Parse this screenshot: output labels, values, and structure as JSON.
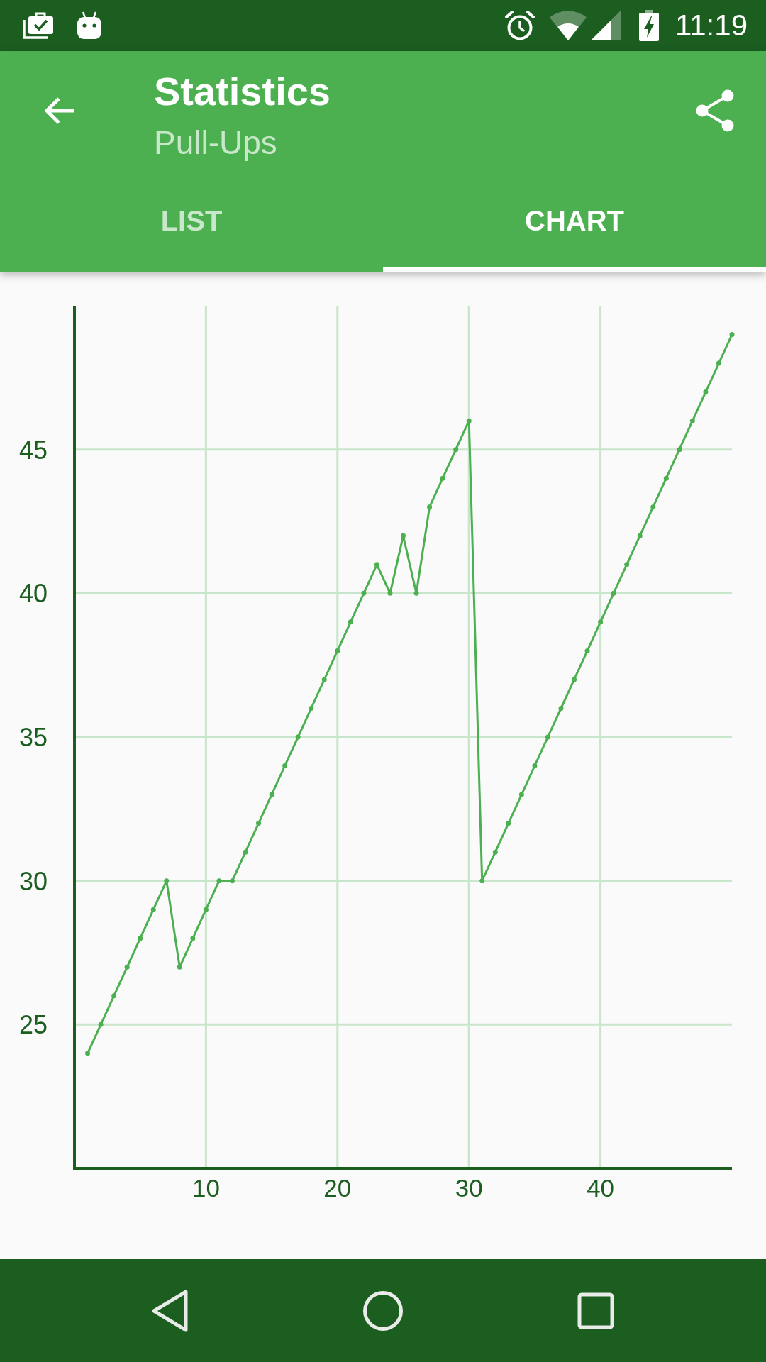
{
  "status_bar": {
    "time": "11:19"
  },
  "app_bar": {
    "title": "Statistics",
    "subtitle": "Pull-Ups"
  },
  "tabs": [
    {
      "label": "LIST",
      "selected": false
    },
    {
      "label": "CHART",
      "selected": true
    }
  ],
  "chart": {
    "chart_data": {
      "type": "line",
      "grid": true,
      "x": [
        1,
        2,
        3,
        4,
        5,
        6,
        7,
        8,
        9,
        10,
        11,
        12,
        13,
        14,
        15,
        16,
        17,
        18,
        19,
        20,
        21,
        22,
        23,
        24,
        25,
        26,
        27,
        28,
        29,
        30,
        31,
        32,
        33,
        34,
        35,
        36,
        37,
        38,
        39,
        40,
        41,
        42,
        43,
        44,
        45,
        46,
        47,
        48,
        49,
        50
      ],
      "series": [
        {
          "color": "#4caf50",
          "marker": true,
          "values": [
            24,
            25,
            26,
            27,
            28,
            29,
            30,
            27,
            28,
            29,
            30,
            30,
            31,
            32,
            33,
            34,
            35,
            36,
            37,
            38,
            39,
            40,
            41,
            40,
            42,
            40,
            43,
            44,
            45,
            46,
            30,
            31,
            32,
            33,
            34,
            35,
            36,
            37,
            38,
            39,
            40,
            41,
            42,
            43,
            44,
            45,
            46,
            47,
            48,
            49
          ]
        }
      ],
      "xlim": [
        0,
        50
      ],
      "ylim": [
        20,
        50
      ],
      "xticks": [
        10,
        20,
        30,
        40
      ],
      "yticks": [
        25,
        30,
        35,
        40,
        45
      ]
    }
  }
}
